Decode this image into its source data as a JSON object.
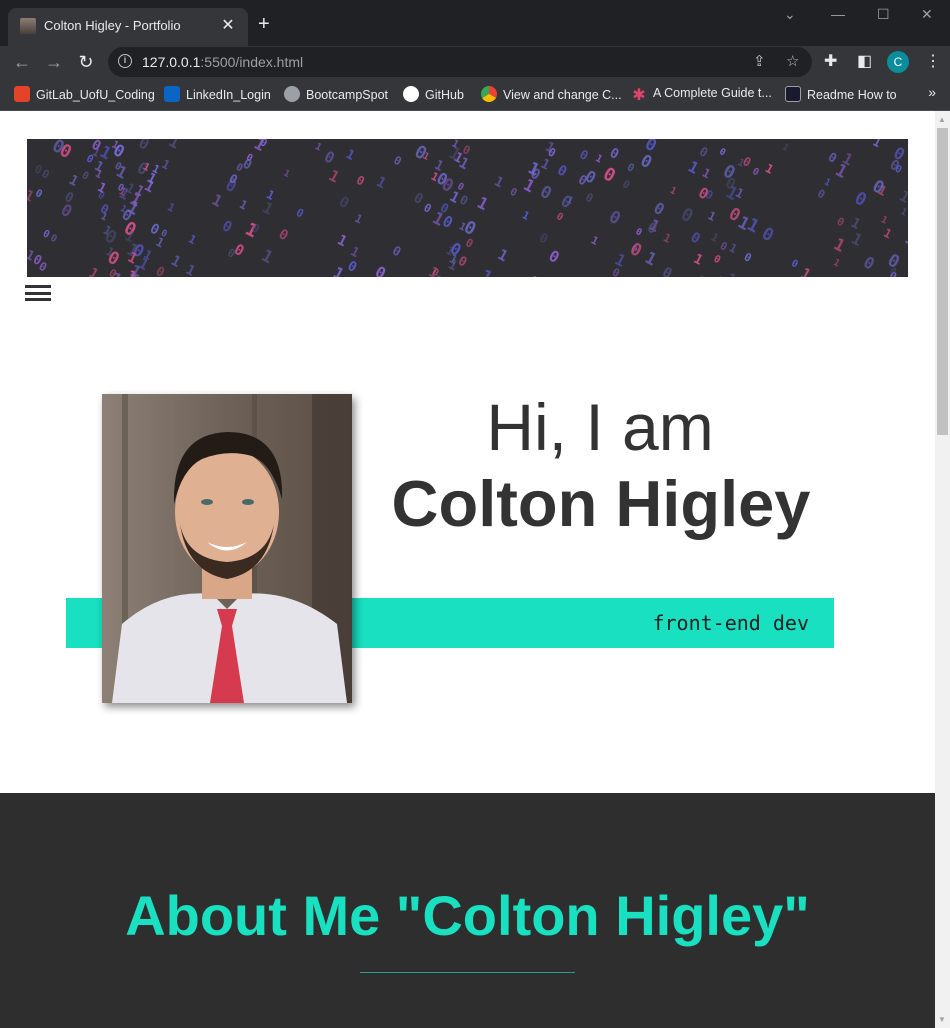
{
  "browser": {
    "tab_title": "Colton Higley - Portfolio",
    "url_host": "127.0.0.1",
    "url_rest": ":5500/index.html",
    "profile_initial": "C",
    "bookmarks": [
      {
        "label": "GitLab_UofU_Coding",
        "icon": "gitlab-icon",
        "color": "#e24329"
      },
      {
        "label": "LinkedIn_Login",
        "icon": "linkedin-icon",
        "color": "#0a66c2"
      },
      {
        "label": "BootcampSpot",
        "icon": "globe-icon",
        "color": "#9aa0a6"
      },
      {
        "label": "GitHub",
        "icon": "github-icon",
        "color": "#ffffff"
      },
      {
        "label": "View and change C...",
        "icon": "chrome-icon",
        "color": "#fbbc04"
      },
      {
        "label": "A Complete Guide t...",
        "icon": "asterisk-icon",
        "color": "#e0446a"
      },
      {
        "label": "Readme How to",
        "icon": "angular-icon",
        "color": "#dd0031"
      }
    ]
  },
  "hero": {
    "greeting": "Hi, I am",
    "name": "Colton Higley",
    "role": "front-end dev"
  },
  "about": {
    "title": "About Me \"Colton Higley\""
  },
  "colors": {
    "accent": "#18e0c0",
    "dark_section": "#2e2e2e",
    "text": "#333333"
  }
}
